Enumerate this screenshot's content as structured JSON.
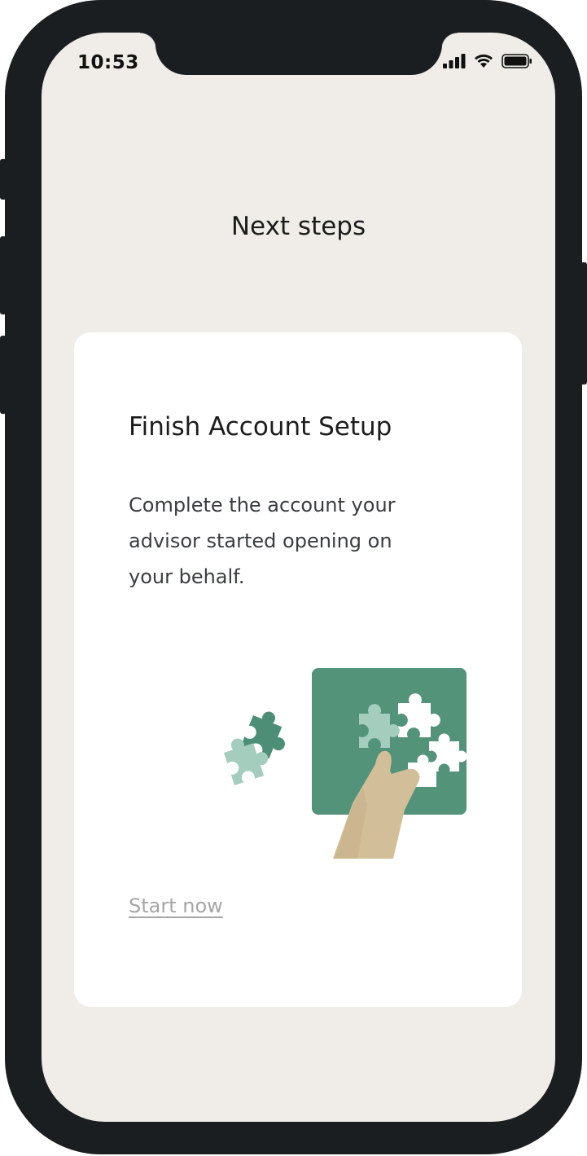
{
  "status_bar": {
    "time": "10:53",
    "icons": [
      "signal-icon",
      "wifi-icon",
      "battery-icon"
    ]
  },
  "page": {
    "title": "Next steps"
  },
  "card": {
    "title": "Finish Account Setup",
    "description": "Complete the account your advisor started opening on your behalf.",
    "illustration": "puzzle-hand-illustration",
    "action_label": "Start now"
  },
  "colors": {
    "background": "#f0ede8",
    "card": "#ffffff",
    "accent_green": "#4d8f76",
    "link_gray": "#a6a6a6",
    "frame": "#1b1e20"
  }
}
